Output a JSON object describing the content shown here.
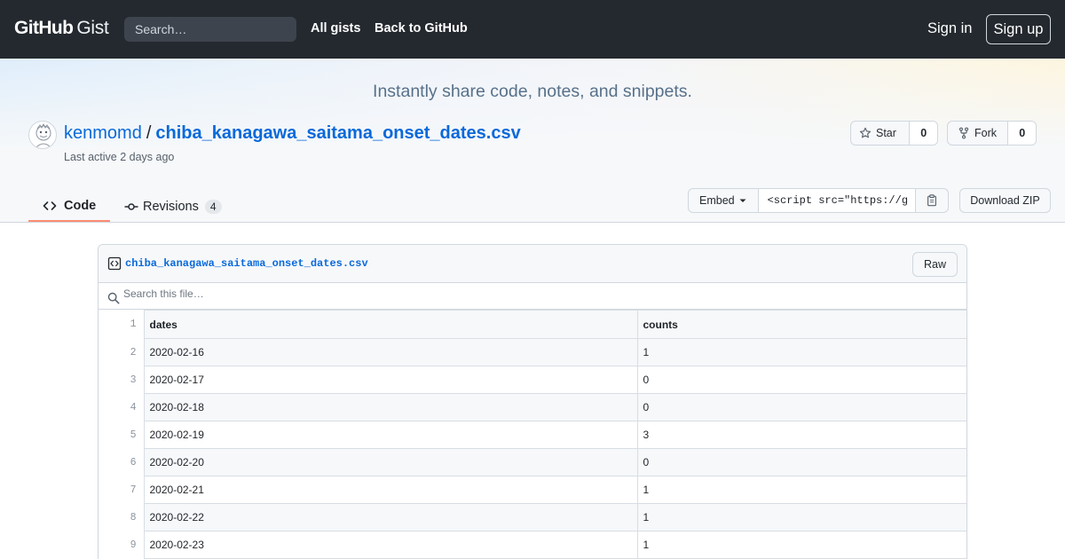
{
  "header": {
    "logo_primary": "GitHub",
    "logo_secondary": "Gist",
    "search_placeholder": "Search…",
    "nav": [
      "All gists",
      "Back to GitHub"
    ],
    "sign_in": "Sign in",
    "sign_up": "Sign up"
  },
  "hero": {
    "tagline": "Instantly share code, notes, and snippets."
  },
  "gist": {
    "owner": "kenmomd",
    "separator": "/",
    "filename": "chiba_kanagawa_saitama_onset_dates.csv",
    "last_active": "Last active 2 days ago",
    "star_label": "Star",
    "star_count": "0",
    "fork_label": "Fork",
    "fork_count": "0"
  },
  "tabs": {
    "code": "Code",
    "revisions": "Revisions",
    "revisions_count": "4"
  },
  "embed": {
    "label": "Embed",
    "value": "<script src=\"https://g",
    "download": "Download ZIP"
  },
  "file": {
    "name": "chiba_kanagawa_saitama_onset_dates.csv",
    "raw_label": "Raw",
    "search_placeholder": "Search this file…",
    "columns": [
      "dates",
      "counts"
    ],
    "rows": [
      [
        "2020-02-16",
        "1"
      ],
      [
        "2020-02-17",
        "0"
      ],
      [
        "2020-02-18",
        "0"
      ],
      [
        "2020-02-19",
        "3"
      ],
      [
        "2020-02-20",
        "0"
      ],
      [
        "2020-02-21",
        "1"
      ],
      [
        "2020-02-22",
        "1"
      ],
      [
        "2020-02-23",
        "1"
      ]
    ]
  },
  "colors": {
    "header_bg": "#24292f",
    "link": "#0969da",
    "tab_underline": "#fd8c73"
  }
}
